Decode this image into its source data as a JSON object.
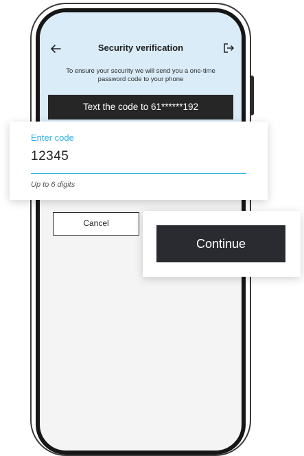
{
  "screen": {
    "title": "Security verification",
    "description": "To ensure your security we will send you a one-time password code to your phone",
    "sms_banner": "Text the code to 61******192"
  },
  "code_field": {
    "label": "Enter code",
    "value": "12345",
    "hint": "Up to 6 digits"
  },
  "actions": {
    "cancel_label": "Cancel",
    "continue_label": "Continue"
  },
  "icons": {
    "back": "back-arrow-icon",
    "logout": "logout-icon"
  },
  "colors": {
    "header_bg": "#d9ecf8",
    "accent": "#2cb3e6",
    "banner_bg": "#262626",
    "primary_button": "#2a2b30"
  }
}
